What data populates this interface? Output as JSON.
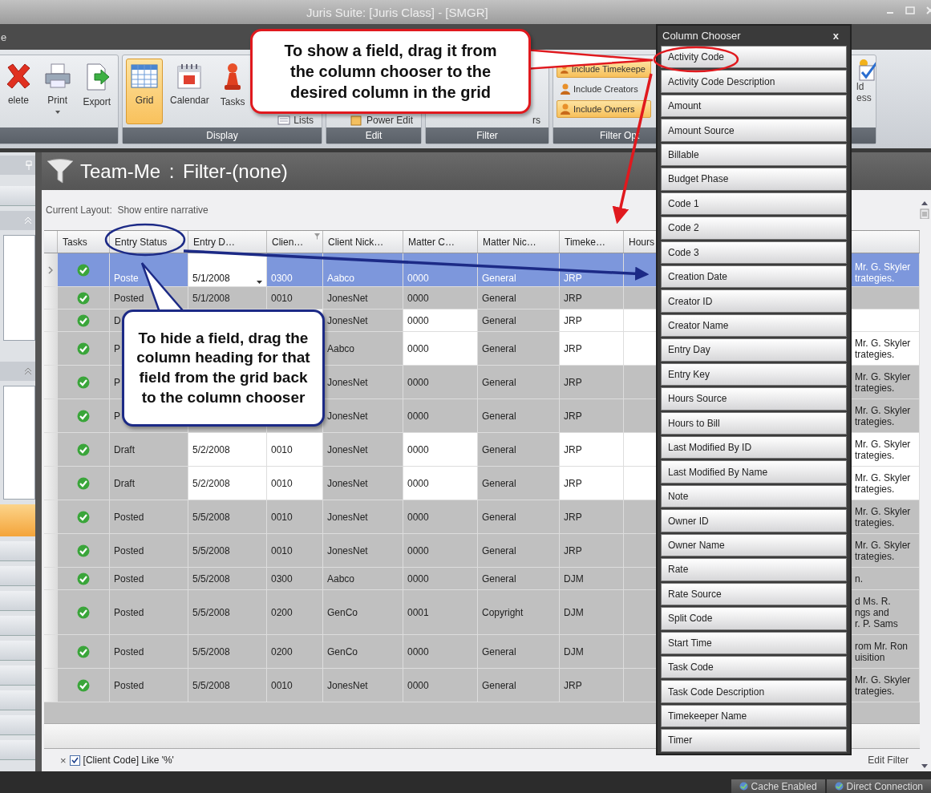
{
  "window": {
    "title": "Juris Suite: [Juris Class] - [SMGR]"
  },
  "menu_bar": {
    "items": [
      "e"
    ]
  },
  "ribbon": {
    "groups": [
      {
        "kind": "large",
        "buttons": [
          {
            "label": "elete"
          },
          {
            "label": "Print",
            "dropdown": true
          },
          {
            "label": "Export"
          }
        ]
      },
      {
        "kind": "large",
        "label": "Display",
        "buttons": [
          {
            "label": "Grid",
            "selected": true
          },
          {
            "label": "Calendar",
            "selected": false
          },
          {
            "label": "Tasks",
            "selected": false
          }
        ],
        "small_buttons": [
          {
            "label": "Lists"
          }
        ]
      },
      {
        "kind": "small",
        "label": "Edit",
        "small_buttons": [
          {
            "label": "Power Edit"
          }
        ]
      },
      {
        "kind": "small",
        "label": "Filter",
        "small_buttons": [
          {
            "label": "rs"
          }
        ]
      },
      {
        "kind": "toggles",
        "label": "Filter Opt",
        "toggles": [
          {
            "label": "Include Timekeepe",
            "on": true
          },
          {
            "label": "Include Creators",
            "on": false
          },
          {
            "label": "Include Owners",
            "on": true
          }
        ]
      },
      {
        "kind": "fragment",
        "texts": [
          "ld",
          "ess"
        ]
      }
    ]
  },
  "view": {
    "title": "Team-Me : Filter-(none)",
    "layout_label": "Current Layout:  Show entire narrative"
  },
  "grid": {
    "columns": [
      {
        "label": "Tasks",
        "shaded": true
      },
      {
        "label": "Entry Status",
        "shaded": true
      },
      {
        "label": "Entry D…",
        "shaded": false
      },
      {
        "label": "Clien…",
        "shaded": false,
        "filtered": true
      },
      {
        "label": "Client Nick…",
        "shaded": true
      },
      {
        "label": "Matter C…",
        "shaded": false
      },
      {
        "label": "Matter Nic…",
        "shaded": true
      },
      {
        "label": "Timeke…",
        "shaded": false
      },
      {
        "label": "Hours",
        "shaded": false
      },
      {
        "shaded": false
      }
    ],
    "rows": [
      {
        "current": true,
        "selected": false,
        "editing": true,
        "task_done": true,
        "cells": [
          null,
          "Poste",
          "5/1/2008",
          "0300",
          "Aabco",
          "0000",
          "General",
          "JRP",
          null,
          "Mr. G. Skyler\ntrategies."
        ]
      },
      {
        "current": false,
        "selected": true,
        "task_done": true,
        "cells": [
          null,
          "Posted",
          "5/1/2008",
          "0010",
          "JonesNet",
          "0000",
          "General",
          "JRP",
          null,
          null
        ]
      },
      {
        "current": false,
        "selected": false,
        "task_done": true,
        "cells": [
          null,
          "D",
          null,
          null,
          "JonesNet",
          "0000",
          "General",
          "JRP",
          null,
          null
        ]
      },
      {
        "current": false,
        "selected": false,
        "task_done": true,
        "cells": [
          null,
          "P",
          null,
          null,
          "Aabco",
          "0000",
          "General",
          "JRP",
          null,
          "Mr. G. Skyler\ntrategies."
        ]
      },
      {
        "current": false,
        "selected": true,
        "task_done": true,
        "cells": [
          null,
          "P",
          null,
          null,
          "JonesNet",
          "0000",
          "General",
          "JRP",
          null,
          "Mr. G. Skyler\ntrategies."
        ]
      },
      {
        "current": false,
        "selected": true,
        "task_done": true,
        "cells": [
          null,
          "P",
          null,
          null,
          "JonesNet",
          "0000",
          "General",
          "JRP",
          null,
          "Mr. G. Skyler\ntrategies."
        ]
      },
      {
        "current": false,
        "selected": false,
        "task_done": true,
        "cells": [
          null,
          "Draft",
          "5/2/2008",
          "0010",
          "JonesNet",
          "0000",
          "General",
          "JRP",
          null,
          "Mr. G. Skyler\ntrategies."
        ]
      },
      {
        "current": false,
        "selected": false,
        "task_done": true,
        "cells": [
          null,
          "Draft",
          "5/2/2008",
          "0010",
          "JonesNet",
          "0000",
          "General",
          "JRP",
          null,
          "Mr. G. Skyler\ntrategies."
        ]
      },
      {
        "current": false,
        "selected": true,
        "task_done": true,
        "cells": [
          null,
          "Posted",
          "5/5/2008",
          "0010",
          "JonesNet",
          "0000",
          "General",
          "JRP",
          null,
          "Mr. G. Skyler\ntrategies."
        ]
      },
      {
        "current": false,
        "selected": true,
        "task_done": true,
        "cells": [
          null,
          "Posted",
          "5/5/2008",
          "0010",
          "JonesNet",
          "0000",
          "General",
          "JRP",
          null,
          "Mr. G. Skyler\ntrategies."
        ]
      },
      {
        "current": false,
        "selected": true,
        "task_done": true,
        "cells": [
          null,
          "Posted",
          "5/5/2008",
          "0300",
          "Aabco",
          "0000",
          "General",
          "DJM",
          null,
          "n."
        ]
      },
      {
        "current": false,
        "selected": true,
        "task_done": true,
        "cells": [
          null,
          "Posted",
          "5/5/2008",
          "0200",
          "GenCo",
          "0001",
          "Copyright",
          "DJM",
          null,
          "d Ms. R.\nngs and\nr. P. Sams"
        ]
      },
      {
        "current": false,
        "selected": true,
        "task_done": true,
        "cells": [
          null,
          "Posted",
          "5/5/2008",
          "0200",
          "GenCo",
          "0000",
          "General",
          "DJM",
          null,
          "rom Mr. Ron\nuisition"
        ]
      },
      {
        "current": false,
        "selected": true,
        "task_done": true,
        "cells": [
          null,
          "Posted",
          "5/5/2008",
          "0010",
          "JonesNet",
          "0000",
          "General",
          "JRP",
          null,
          "Mr. G. Skyler\ntrategies."
        ]
      }
    ]
  },
  "filter_bar": {
    "clear": "×",
    "checked": true,
    "expression": "[Client Code] Like '%'",
    "edit_label": "Edit Filter"
  },
  "status_bar": {
    "items": [
      "Cache Enabled",
      "Direct Connection"
    ]
  },
  "column_chooser": {
    "title": "Column Chooser",
    "close": "x",
    "items": [
      "Activity Code",
      "Activity Code Description",
      "Amount",
      "Amount Source",
      "Billable",
      "Budget Phase",
      "Code 1",
      "Code 2",
      "Code 3",
      "Creation Date",
      "Creator ID",
      "Creator Name",
      "Entry Day",
      "Entry Key",
      "Hours Source",
      "Hours to Bill",
      "Last Modified By ID",
      "Last Modified By Name",
      "Note",
      "Owner ID",
      "Owner Name",
      "Rate",
      "Rate Source",
      "Split Code",
      "Start Time",
      "Task Code",
      "Task Code Description",
      "Timekeeper Name",
      "Timer"
    ]
  },
  "callouts": [
    {
      "text": "To show a field, drag it from the column chooser to the desired column in the grid",
      "color": "#e0191e"
    },
    {
      "text": "To hide a field, drag the column heading for that field from the grid back to the column chooser",
      "color": "#1c2a86"
    }
  ]
}
